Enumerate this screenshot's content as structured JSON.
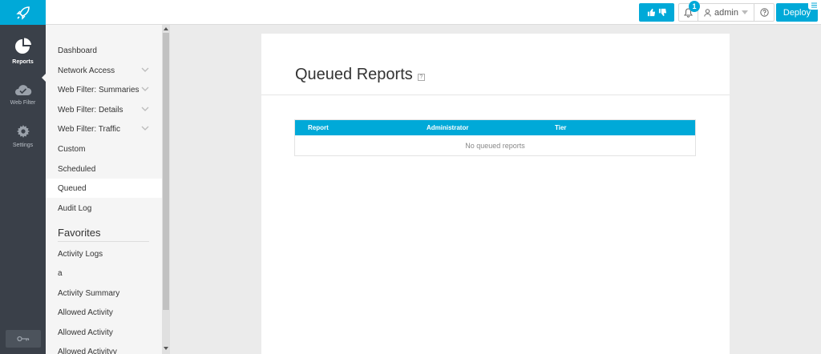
{
  "header": {
    "user": "admin",
    "notification_count": "1",
    "deploy_label": "Deploy"
  },
  "rail": {
    "items": [
      {
        "label": "Reports"
      },
      {
        "label": "Web Filter"
      },
      {
        "label": "Settings"
      }
    ]
  },
  "submenu": {
    "items": [
      {
        "label": "Dashboard"
      },
      {
        "label": "Network Access"
      },
      {
        "label": "Web Filter: Summaries"
      },
      {
        "label": "Web Filter: Details"
      },
      {
        "label": "Web Filter: Traffic"
      },
      {
        "label": "Custom"
      },
      {
        "label": "Scheduled"
      },
      {
        "label": "Queued"
      },
      {
        "label": "Audit Log"
      }
    ],
    "favorites_heading": "Favorites",
    "favorites": [
      {
        "label": "Activity Logs"
      },
      {
        "label": "a"
      },
      {
        "label": "Activity Summary"
      },
      {
        "label": "Allowed Activity"
      },
      {
        "label": "Allowed Activity"
      },
      {
        "label": "Allowed Activityy"
      }
    ]
  },
  "main": {
    "title": "Queued Reports",
    "table": {
      "columns": [
        "Report",
        "Administrator",
        "Tier"
      ],
      "empty_message": "No queued reports"
    }
  },
  "colors": {
    "accent": "#00a9d8",
    "rail": "#3a4049"
  }
}
